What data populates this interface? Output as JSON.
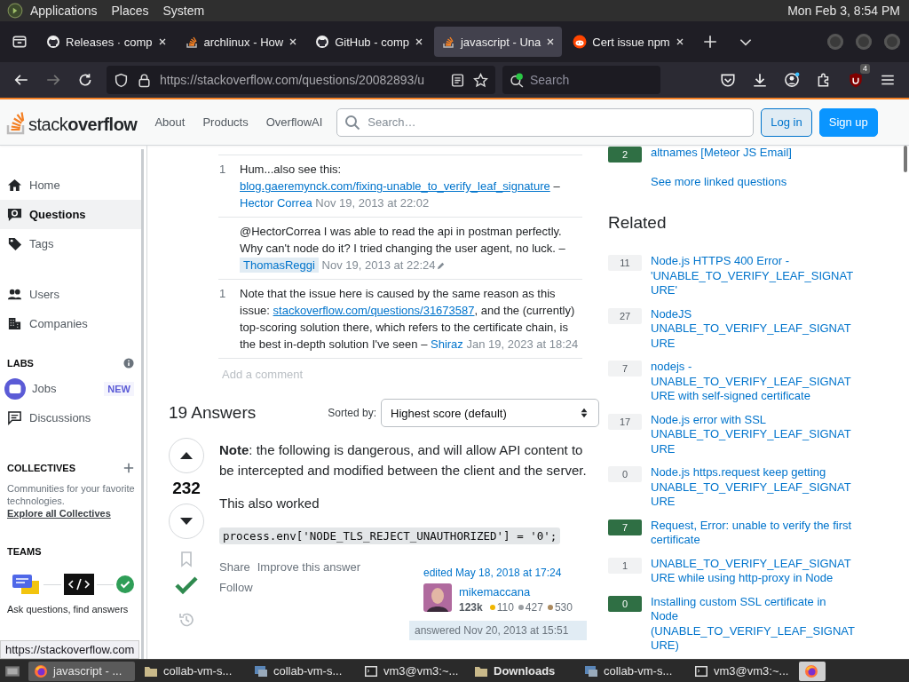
{
  "top_panel": {
    "menus": [
      "Applications",
      "Places",
      "System"
    ],
    "clock": "Mon Feb  3,  8:54 PM"
  },
  "browser": {
    "tabs": [
      {
        "title": "Releases · comp",
        "kind": "github",
        "selected": false
      },
      {
        "title": "archlinux - How",
        "kind": "stack",
        "selected": false
      },
      {
        "title": "GitHub - comp",
        "kind": "github",
        "selected": false
      },
      {
        "title": "javascript - Una",
        "kind": "stack",
        "selected": true
      },
      {
        "title": "Cert issue npm",
        "kind": "reddit",
        "selected": false
      }
    ],
    "url": "https://stackoverflow.com/questions/20082893/u",
    "search_placeholder": "Search",
    "extension_badge": "4"
  },
  "so_header": {
    "logo_light": "stack",
    "logo_bold": "overflow",
    "nav": [
      "About",
      "Products",
      "OverflowAI"
    ],
    "search_placeholder": "Search…",
    "login": "Log in",
    "signup": "Sign up"
  },
  "sidebar": {
    "groups": [
      [
        {
          "label": "Home",
          "kind": "home",
          "selected": false
        },
        {
          "label": "Questions",
          "kind": "questions",
          "selected": true
        },
        {
          "label": "Tags",
          "kind": "tags",
          "selected": false
        }
      ],
      [
        {
          "label": "Users",
          "kind": "users",
          "selected": false
        },
        {
          "label": "Companies",
          "kind": "companies",
          "selected": false
        }
      ]
    ],
    "labs": {
      "heading": "LABS",
      "items": [
        {
          "label": "Jobs",
          "kind": "jobs",
          "badge": "NEW",
          "focused": true
        },
        {
          "label": "Discussions",
          "kind": "discussions",
          "focused": false
        }
      ]
    },
    "collectives": {
      "heading": "COLLECTIVES",
      "text": "Communities for your favorite technologies.",
      "link": "Explore all Collectives"
    },
    "teams": {
      "heading": "TEAMS",
      "text": "Ask questions, find answers"
    }
  },
  "comments": [
    {
      "score": "1",
      "text": "Hum...also see this: ",
      "link": "blog.gaeremynck.com/fixing-unable_to_verify_leaf_signature",
      "dash": "–",
      "author": "Hector Correa",
      "author_is_op": false,
      "date": "Nov 19, 2013 at 22:02",
      "edited": false
    },
    {
      "text": "@HectorCorrea I was able to read the api in postman perfectly. Why can't node do it? I tried changing the user agent, no luck.",
      "dash": "–",
      "author": "ThomasReggi",
      "author_is_op": true,
      "date": "Nov 19, 2013 at 22:24",
      "edited": true
    },
    {
      "score": "1",
      "text": "Note that the issue here is caused by the same reason as this issue: ",
      "link": "stackoverflow.com/questions/31673587",
      "after": ", and the (currently) top-scoring solution there, which refers to the certificate chain, is the best in-depth solution I've seen",
      "dash": "–",
      "author": "Shiraz",
      "author_is_op": false,
      "date": "Jan 19, 2023 at 18:24",
      "edited": false
    }
  ],
  "add_comment": "Add a comment",
  "answers": {
    "count_label": "19 Answers",
    "sort_label": "Sorted by:",
    "sort_value": "Highest score (default)",
    "answer": {
      "votes": "232",
      "accepted": true,
      "paragraphs": [
        "**Note**: the following is dangerous, and will allow API content to be intercepted and modified between the client and the server.",
        "This also worked"
      ],
      "code": "process.env['NODE_TLS_REJECT_UNAUTHORIZED'] = '0';",
      "actions": [
        "Share",
        "Improve this answer",
        "Follow"
      ],
      "edited": "edited May 18, 2018 at 17:24",
      "user": "mikemaccana",
      "reputation": "123k",
      "badges": [
        {
          "color": "#f1b600",
          "count": "110"
        },
        {
          "color": "#9a9ea2",
          "count": "427"
        },
        {
          "color": "#ab8a5f",
          "count": "530"
        }
      ],
      "answered": "answered Nov 20, 2013 at 15:51"
    }
  },
  "linked": {
    "items": [
      {
        "score": "2",
        "accepted": true,
        "title": "altnames [Meteor JS Email]"
      }
    ],
    "more": "See more linked questions"
  },
  "related": {
    "heading": "Related",
    "items": [
      {
        "score": "11",
        "accepted": false,
        "title": "Node.js HTTPS 400 Error - 'UNABLE_TO_VERIFY_LEAF_SIGNATURE'"
      },
      {
        "score": "27",
        "accepted": false,
        "title": "NodeJS UNABLE_TO_VERIFY_LEAF_SIGNATURE"
      },
      {
        "score": "7",
        "accepted": false,
        "title": "nodejs - UNABLE_TO_VERIFY_LEAF_SIGNATURE with self-signed certificate"
      },
      {
        "score": "17",
        "accepted": false,
        "title": "Node.js error with SSL UNABLE_TO_VERIFY_LEAF_SIGNATURE"
      },
      {
        "score": "0",
        "accepted": false,
        "title": "Node.js https.request keep getting UNABLE_TO_VERIFY_LEAF_SIGNATURE"
      },
      {
        "score": "7",
        "accepted": true,
        "title": "Request, Error: unable to verify the first certificate"
      },
      {
        "score": "1",
        "accepted": false,
        "title": "UNABLE_TO_VERIFY_LEAF_SIGNATURE while using http-proxy in Node"
      },
      {
        "score": "0",
        "accepted": true,
        "title": "Installing custom SSL certificate in Node (UNABLE_TO_VERIFY_LEAF_SIGNATURE)"
      }
    ]
  },
  "status_url": "https://stackoverflow.com",
  "taskbar": {
    "items": [
      {
        "kind": "firefox",
        "label": "javascript - ...",
        "selected": true,
        "bold": false
      },
      {
        "kind": "folder",
        "label": "collab-vm-s...",
        "selected": false,
        "bold": false
      },
      {
        "kind": "remote",
        "label": "collab-vm-s...",
        "selected": false,
        "bold": false
      },
      {
        "kind": "terminal",
        "label": "vm3@vm3:~...",
        "selected": false,
        "bold": false
      },
      {
        "kind": "folder",
        "label": "Downloads",
        "selected": false,
        "bold": true
      },
      {
        "kind": "remote",
        "label": "collab-vm-s...",
        "selected": false,
        "bold": false
      },
      {
        "kind": "terminal",
        "label": "vm3@vm3:~...",
        "selected": false,
        "bold": false
      }
    ],
    "launcher": {
      "kind": "firefox"
    }
  }
}
